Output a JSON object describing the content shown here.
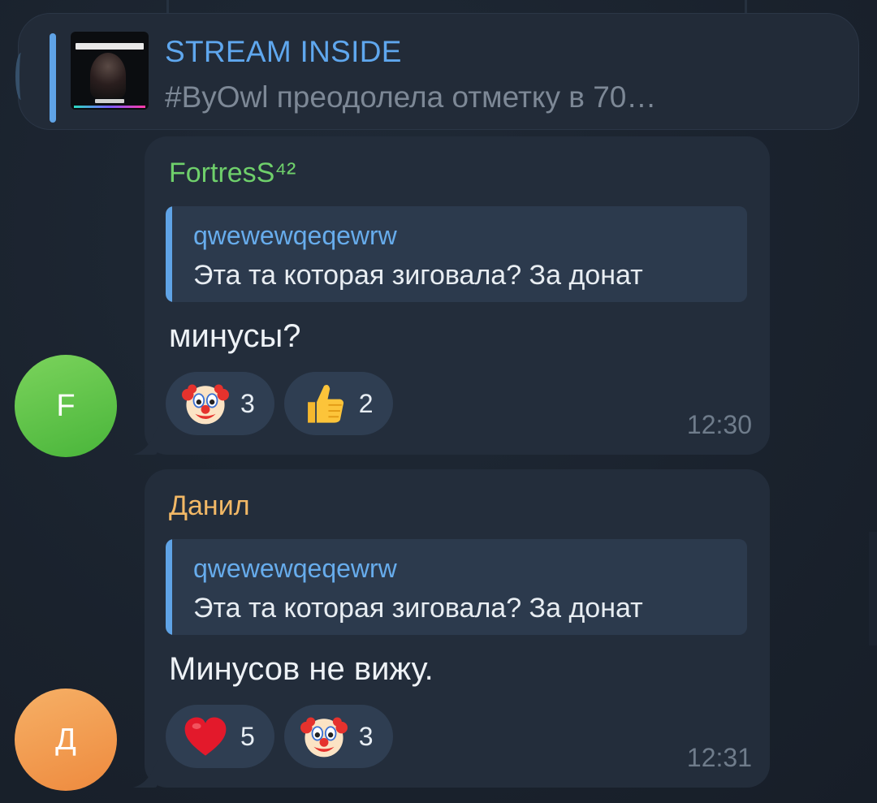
{
  "pinned": {
    "title": "STREAM INSIDE",
    "preview": "#ByOwl преодолела отметку в 70…"
  },
  "messages": [
    {
      "avatar_letter": "F",
      "sender": "FortresS⁴²",
      "reply_name": "qwewewqeqewrw",
      "reply_text": "Эта та которая зиговала? За донат",
      "text": "минусы?",
      "reactions": [
        {
          "emoji": "clown-face",
          "count": "3"
        },
        {
          "emoji": "thumbs-up",
          "count": "2"
        }
      ],
      "time": "12:30"
    },
    {
      "avatar_letter": "Д",
      "sender": "Данил",
      "reply_name": "qwewewqeqewrw",
      "reply_text": "Эта та которая зиговала? За донат",
      "text": "Минусов не вижу.",
      "reactions": [
        {
          "emoji": "red-heart",
          "count": "5"
        },
        {
          "emoji": "clown-face",
          "count": "3"
        }
      ],
      "time": "12:31"
    }
  ],
  "colors": {
    "background": "#1b2330",
    "bubble": "#232d3b",
    "accent": "#5fa3e6",
    "sender1": "#6fd06b",
    "sender2": "#f2b866",
    "avatar1": "#5cc243",
    "avatar2": "#f19a4c"
  }
}
